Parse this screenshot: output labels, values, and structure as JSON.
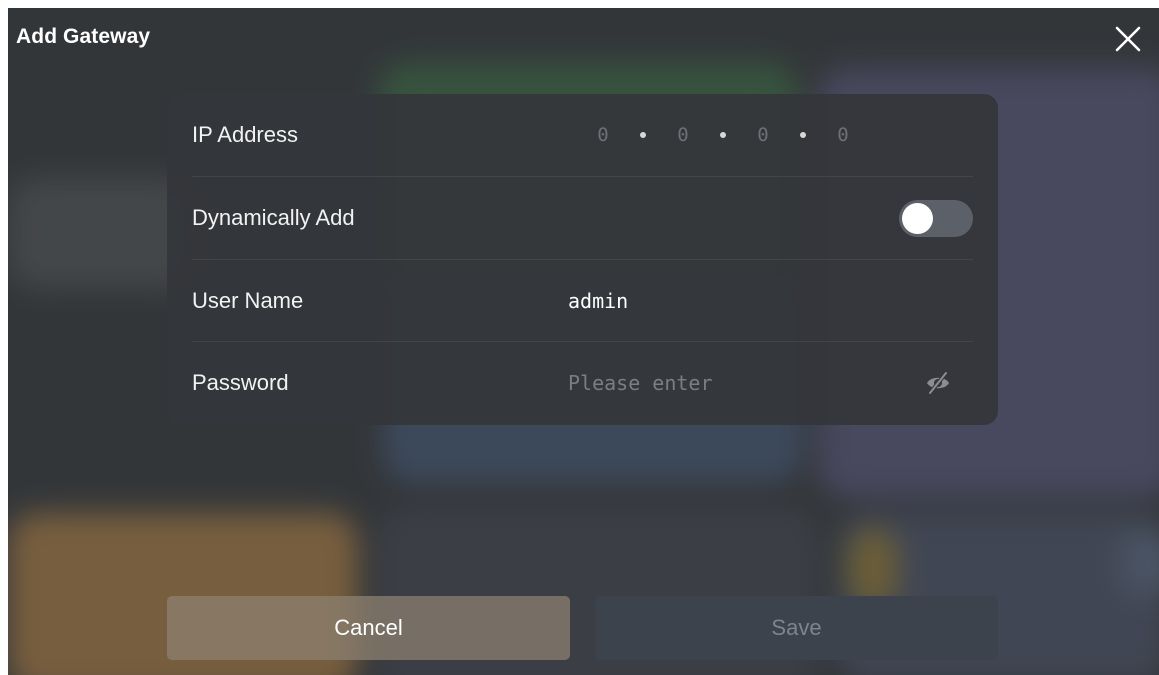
{
  "dialog": {
    "title": "Add Gateway",
    "close_icon": "close-icon"
  },
  "form": {
    "ip_address": {
      "label": "IP Address",
      "octets": [
        "0",
        "0",
        "0",
        "0"
      ]
    },
    "dynamically_add": {
      "label": "Dynamically Add",
      "enabled": false
    },
    "user_name": {
      "label": "User Name",
      "value": "admin"
    },
    "password": {
      "label": "Password",
      "value": "",
      "placeholder": "Please enter",
      "visibility_icon": "eye-off-icon"
    }
  },
  "actions": {
    "cancel_label": "Cancel",
    "save_label": "Save"
  },
  "colors": {
    "panel": "#34363a",
    "cancel_button": "#8c8070",
    "save_button": "#3d434d",
    "save_text_disabled": "#7e848d",
    "toggle_track_off": "#5c6068"
  }
}
